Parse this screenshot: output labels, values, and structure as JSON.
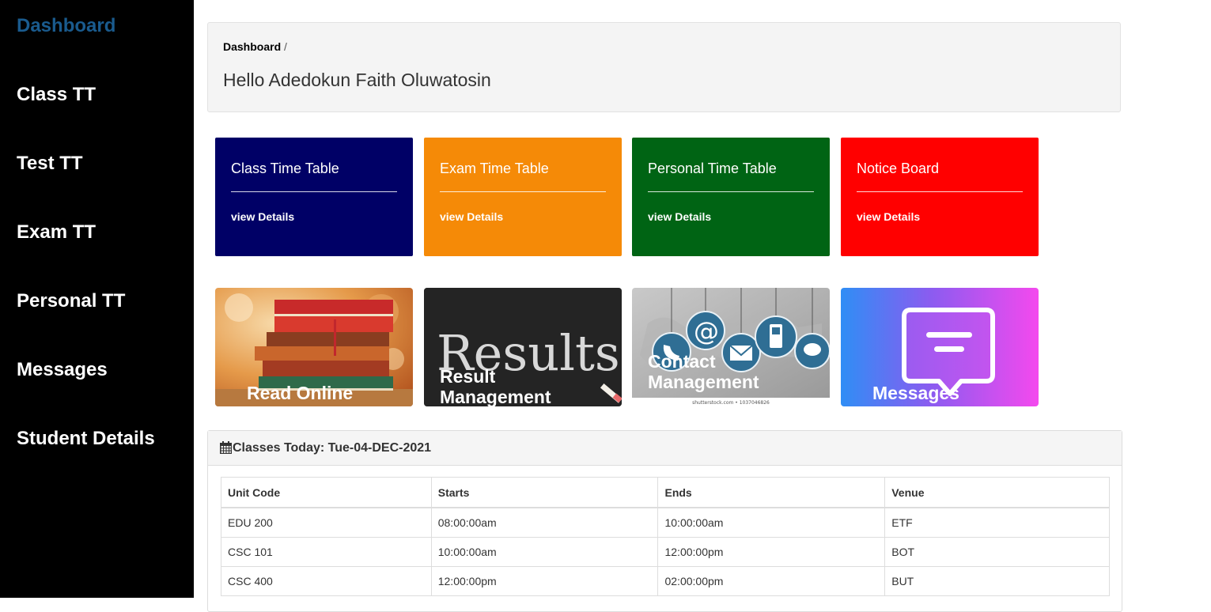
{
  "sidebar": {
    "items": [
      {
        "label": "Dashboard"
      },
      {
        "label": "Class TT"
      },
      {
        "label": "Test TT"
      },
      {
        "label": "Exam TT"
      },
      {
        "label": "Personal TT"
      },
      {
        "label": "Messages"
      },
      {
        "label": "Student Details"
      }
    ],
    "active_color": "#1a5b8e"
  },
  "header": {
    "breadcrumb": "Dashboard",
    "breadcrumb_sep": "/",
    "greeting": "Hello Adedokun Faith Oluwatosin"
  },
  "cards": [
    {
      "title": "Class Time Table",
      "link": "view Details",
      "color": "#000066"
    },
    {
      "title": "Exam Time Table",
      "link": "view Details",
      "color": "#f58a07"
    },
    {
      "title": "Personal Time Table",
      "link": "view Details",
      "color": "#006414"
    },
    {
      "title": "Notice Board",
      "link": "view Details",
      "color": "#ff0000"
    }
  ],
  "tiles": [
    {
      "label": "Read Online",
      "icon": "books-image"
    },
    {
      "label": "Result Management",
      "icon": "chalkboard-results-image",
      "board_text": "Results"
    },
    {
      "label": "Contact Management",
      "icon": "contact-icons-image",
      "watermark": "shutterstock.com • 1037046826"
    },
    {
      "label": "Messages",
      "icon": "message-bubble-icon"
    }
  ],
  "classes": {
    "heading": "Classes Today: Tue-04-DEC-2021",
    "columns": [
      "Unit Code",
      "Starts",
      "Ends",
      "Venue"
    ],
    "rows": [
      [
        "EDU 200",
        "08:00:00am",
        "10:00:00am",
        "ETF"
      ],
      [
        "CSC 101",
        "10:00:00am",
        "12:00:00pm",
        "BOT"
      ],
      [
        "CSC 400",
        "12:00:00pm",
        "02:00:00pm",
        "BUT"
      ]
    ]
  }
}
